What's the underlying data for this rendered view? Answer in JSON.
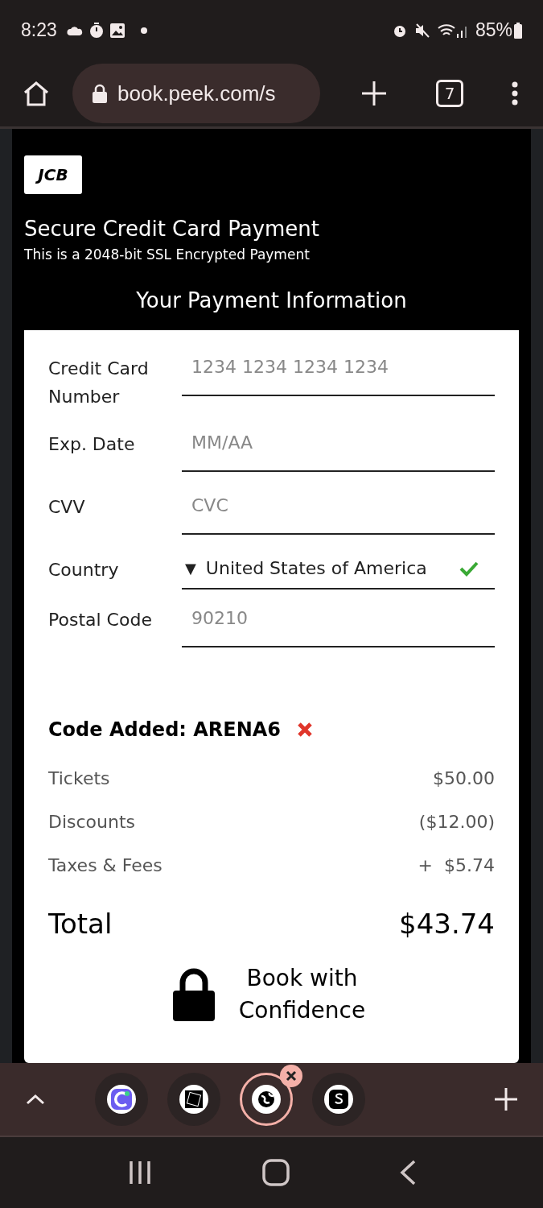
{
  "status_bar": {
    "time": "8:23",
    "battery": "85%"
  },
  "browser": {
    "url": "book.peek.com/s",
    "tab_count": "7"
  },
  "card_header": {
    "brand": "JCB",
    "title": "Secure Credit Card Payment",
    "subtitle": "This is a 2048-bit SSL Encrypted Payment"
  },
  "panel_title": "Your Payment Information",
  "fields": [
    {
      "kind": "input",
      "label": "Credit Card Number",
      "placeholder": "1234 1234 1234 1234"
    },
    {
      "kind": "input",
      "label": "Exp. Date",
      "placeholder": "MM/AA"
    },
    {
      "kind": "input",
      "label": "CVV",
      "placeholder": "CVC"
    },
    {
      "kind": "select",
      "label": "Country",
      "arrow": "▼",
      "value": "United States of America",
      "valid": true
    },
    {
      "kind": "input",
      "label": "Postal Code",
      "placeholder": "90210"
    }
  ],
  "promo": {
    "text": "Code Added: ARENA6"
  },
  "summary": [
    {
      "label": "Tickets",
      "amount": "$50.00"
    },
    {
      "label": "Discounts",
      "amount": "($12.00)"
    },
    {
      "label": "Taxes & Fees",
      "amount": "+  $5.74"
    }
  ],
  "total": {
    "label": "Total",
    "amount": "$43.74"
  },
  "confidence": "Book with Confidence",
  "tab_bar": {
    "tabs": [
      {
        "selected": false
      },
      {
        "selected": false
      },
      {
        "selected": true
      },
      {
        "selected": false
      }
    ]
  }
}
